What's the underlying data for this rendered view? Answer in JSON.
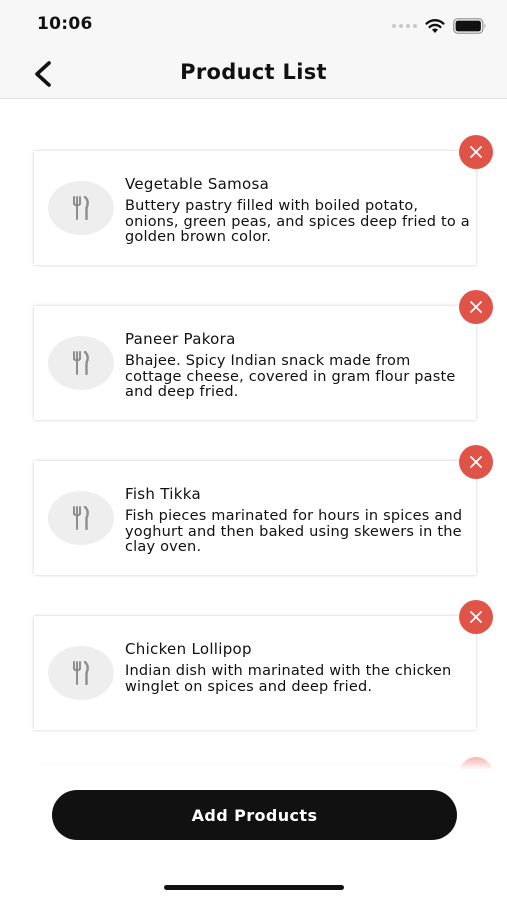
{
  "status_bar": {
    "time": "10:06",
    "icons": [
      "signal-dots-icon",
      "wifi-icon",
      "battery-icon"
    ]
  },
  "nav": {
    "title": "Product List",
    "back_icon": "chevron-left-icon"
  },
  "products": [
    {
      "name": "Vegetable Samosa",
      "description": "Buttery pastry filled with boiled potato, onions, green peas, and spices deep fried to a golden brown color.",
      "icon": "fork-knife-icon"
    },
    {
      "name": "Paneer Pakora",
      "description": "Bhajee. Spicy Indian snack made from cottage cheese, covered in gram flour paste and deep fried.",
      "icon": "fork-knife-icon"
    },
    {
      "name": "Fish Tikka",
      "description": "Fish pieces marinated for hours in spices and yoghurt and then baked using skewers in the clay oven.",
      "icon": "fork-knife-icon"
    },
    {
      "name": "Chicken Lollipop",
      "description": "Indian dish with marinated with the chicken winglet on spices and deep fried.",
      "icon": "fork-knife-icon"
    }
  ],
  "add_button": {
    "label": "Add Products"
  },
  "colors": {
    "remove_button": "#e05448",
    "primary_button": "#111111",
    "thumb_background": "#eeeeee"
  }
}
